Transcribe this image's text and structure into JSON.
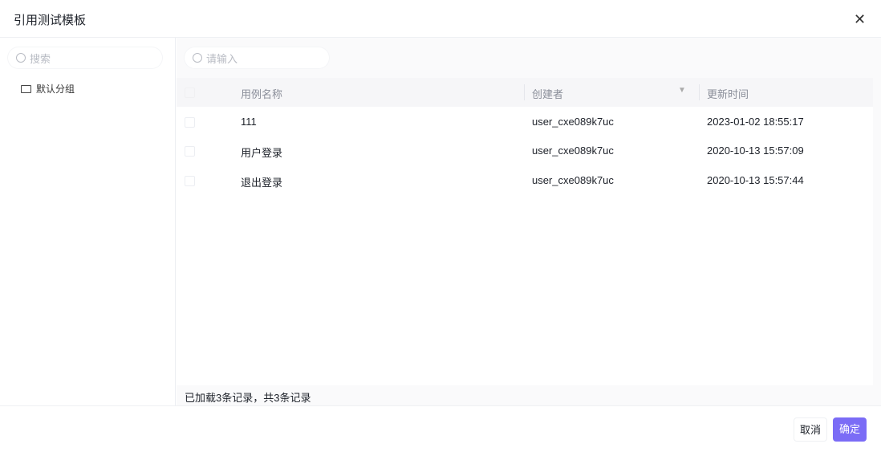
{
  "dialog": {
    "title": "引用测试模板"
  },
  "sidebar": {
    "search_placeholder": "搜索",
    "groups": [
      {
        "label": "默认分组"
      }
    ]
  },
  "main": {
    "search_placeholder": "请输入",
    "columns": [
      "用例名称",
      "创建者",
      "更新时间"
    ],
    "rows": [
      {
        "name": "111",
        "creator": "user_cxe089k7uc",
        "updated": "2023-01-02 18:55:17"
      },
      {
        "name": "用户登录",
        "creator": "user_cxe089k7uc",
        "updated": "2020-10-13 15:57:09"
      },
      {
        "name": "退出登录",
        "creator": "user_cxe089k7uc",
        "updated": "2020-10-13 15:57:44"
      }
    ],
    "summary": "已加载3条记录，共3条记录"
  },
  "footer": {
    "cancel_label": "取消",
    "ok_label": "确定"
  },
  "colors": {
    "accent": "#7b6cf6"
  }
}
